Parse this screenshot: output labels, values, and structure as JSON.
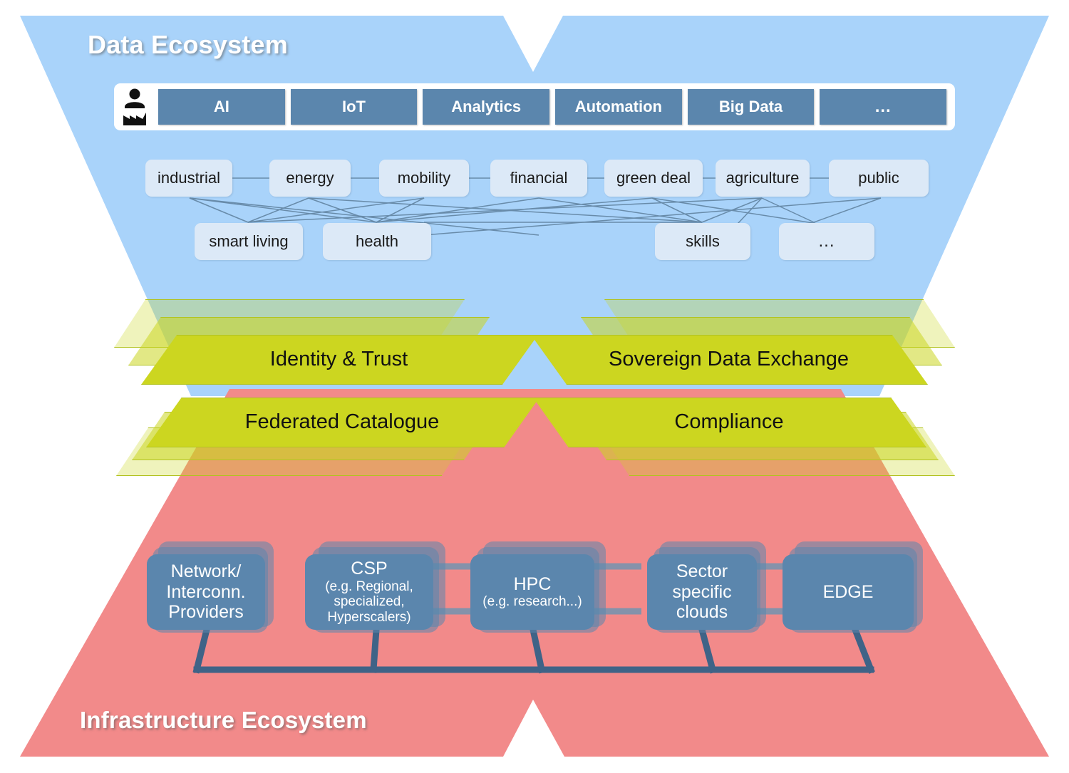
{
  "diagram": {
    "title_top": "Data Ecosystem",
    "title_bottom": "Infrastructure Ecosystem",
    "colors": {
      "data_ecosystem_fill": "#a9d3fa",
      "infrastructure_ecosystem_fill": "#f28a8a",
      "service_band_fill": "#ccd620",
      "node_fill": "#5b86ad",
      "domain_box_fill": "#dce9f7"
    }
  },
  "technologies": {
    "icon": "user-factory-icon",
    "items": [
      {
        "label": "AI"
      },
      {
        "label": "IoT"
      },
      {
        "label": "Analytics"
      },
      {
        "label": "Automation"
      },
      {
        "label": "Big Data"
      },
      {
        "label": "..."
      }
    ]
  },
  "domains": {
    "row1": [
      {
        "label": "industrial"
      },
      {
        "label": "energy"
      },
      {
        "label": "mobility"
      },
      {
        "label": "financial"
      },
      {
        "label": "green deal"
      },
      {
        "label": "agriculture"
      },
      {
        "label": "public"
      }
    ],
    "row2": [
      {
        "label": "smart living"
      },
      {
        "label": "health"
      },
      {
        "label": "skills"
      },
      {
        "label": "..."
      }
    ]
  },
  "services": [
    {
      "label": "Identity & Trust"
    },
    {
      "label": "Sovereign Data Exchange"
    },
    {
      "label": "Federated Catalogue"
    },
    {
      "label": "Compliance"
    }
  ],
  "infrastructure": [
    {
      "main": "Network/",
      "line2": "Interconn.",
      "line3": "Providers",
      "sub": ""
    },
    {
      "main": "CSP",
      "sub1": "(e.g. Regional,",
      "sub2": "specialized,",
      "sub3": "Hyperscalers)"
    },
    {
      "main": "HPC",
      "sub1": "(e.g. research...)"
    },
    {
      "main": "Sector",
      "line2": "specific",
      "line3": "clouds",
      "sub": ""
    },
    {
      "main": "EDGE",
      "sub": ""
    }
  ]
}
